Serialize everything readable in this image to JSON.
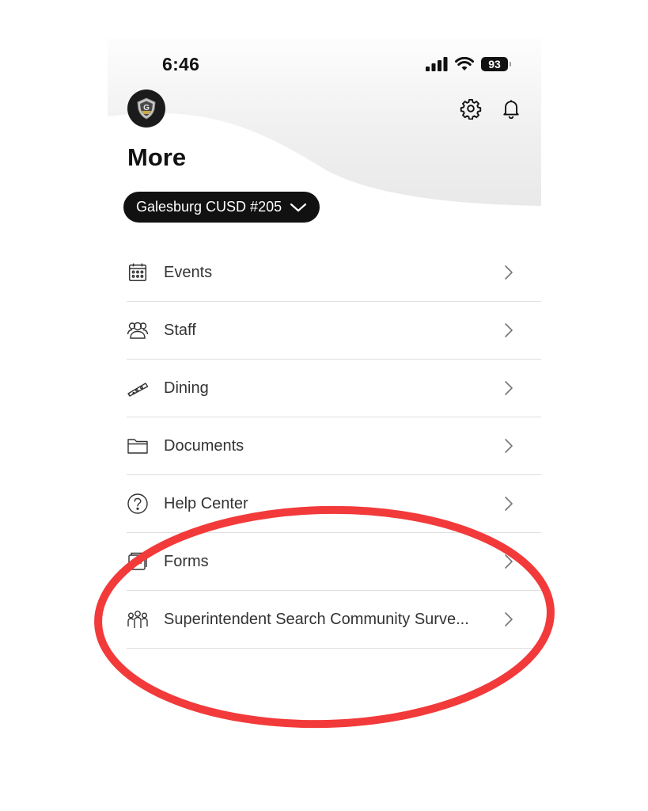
{
  "status_bar": {
    "time": "6:46",
    "battery": "93"
  },
  "header": {
    "title": "More",
    "logo_icon": "district-logo-icon",
    "settings_icon": "gear-icon",
    "notifications_icon": "bell-icon"
  },
  "district_selector": {
    "label": "Galesburg CUSD #205",
    "icon": "chevron-down-icon"
  },
  "menu": {
    "items": [
      {
        "label": "Events",
        "icon": "calendar-icon"
      },
      {
        "label": "Staff",
        "icon": "people-icon"
      },
      {
        "label": "Dining",
        "icon": "pizza-icon"
      },
      {
        "label": "Documents",
        "icon": "folder-icon"
      },
      {
        "label": "Help Center",
        "icon": "question-icon"
      },
      {
        "label": "Forms",
        "icon": "forms-icon"
      },
      {
        "label": "Superintendent Search Community Surve...",
        "icon": "group-icon"
      }
    ]
  },
  "colors": {
    "annotation": "#f23a3a",
    "text": "#333333",
    "pill": "#111111",
    "divider": "#dedede"
  }
}
